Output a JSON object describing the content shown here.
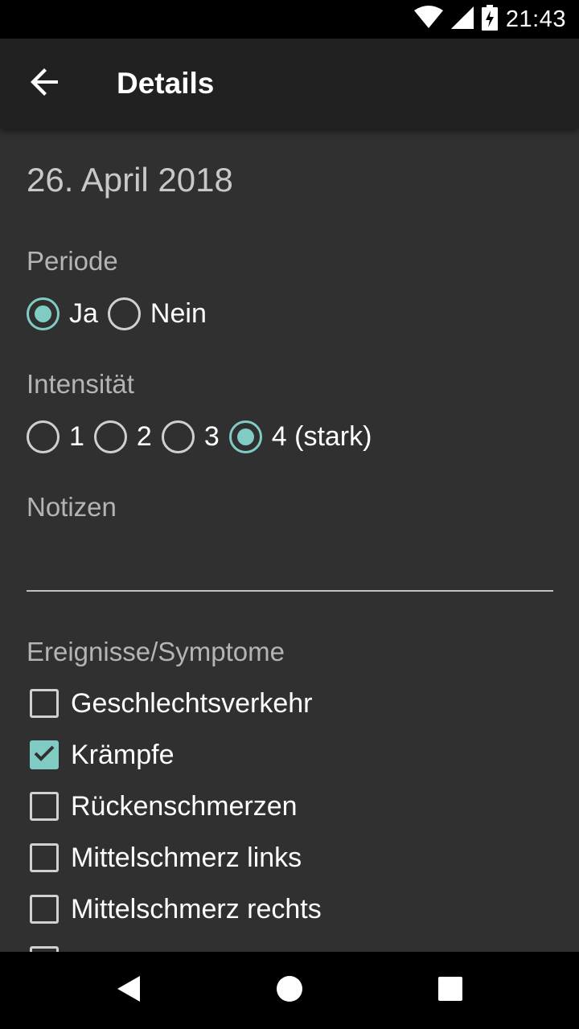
{
  "status_bar": {
    "time": "21:43",
    "icons": [
      "wifi-icon",
      "signal-icon",
      "battery-charging-icon"
    ]
  },
  "toolbar": {
    "title": "Details",
    "back_icon": "arrow-back-icon"
  },
  "entry": {
    "date": "26. April 2018",
    "period": {
      "label": "Periode",
      "options": [
        {
          "label": "Ja",
          "checked": true
        },
        {
          "label": "Nein",
          "checked": false
        }
      ]
    },
    "intensity": {
      "label": "Intensität",
      "options": [
        {
          "label": "1",
          "checked": false
        },
        {
          "label": "2",
          "checked": false
        },
        {
          "label": "3",
          "checked": false
        },
        {
          "label": "4 (stark)",
          "checked": true
        }
      ]
    },
    "notes": {
      "label": "Notizen",
      "value": ""
    },
    "events": {
      "label": "Ereignisse/Symptome",
      "items": [
        {
          "label": "Geschlechtsverkehr",
          "checked": false
        },
        {
          "label": "Krämpfe",
          "checked": true
        },
        {
          "label": "Rückenschmerzen",
          "checked": false
        },
        {
          "label": "Mittelschmerz links",
          "checked": false
        },
        {
          "label": "Mittelschmerz rechts",
          "checked": false
        }
      ]
    }
  },
  "colors": {
    "accent": "#80cbc4",
    "background": "#303030",
    "toolbar": "#212121"
  },
  "nav_bar": {
    "icons": [
      "back-triangle-icon",
      "home-circle-icon",
      "recents-square-icon"
    ]
  }
}
